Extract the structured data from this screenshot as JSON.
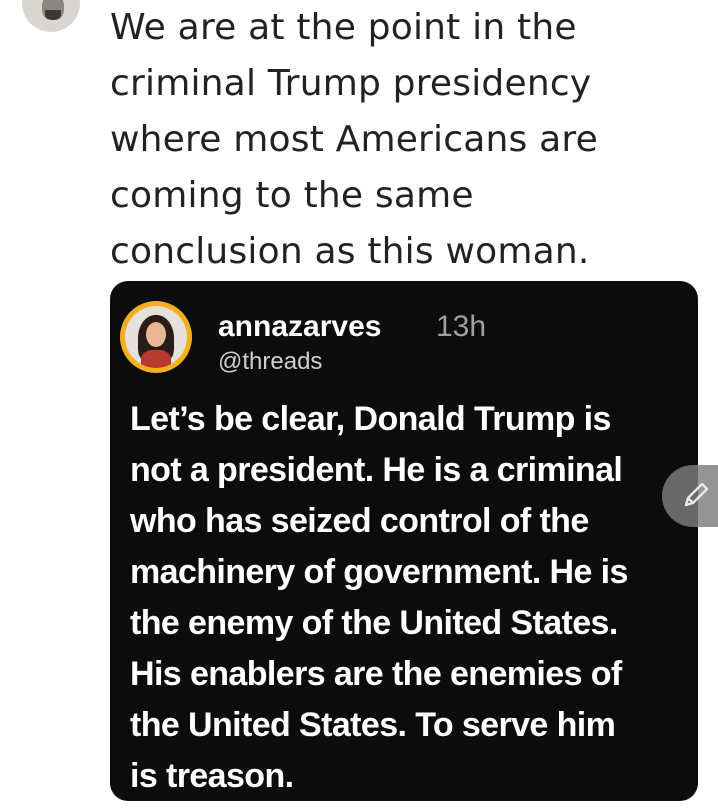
{
  "author": {
    "avatar_icon": "profile-avatar"
  },
  "post": {
    "text": "We are at the point in the\ncriminal Trump presidency\nwhere most Americans are\ncoming to the same\nconclusion as this woman."
  },
  "embedded_card": {
    "avatar_icon": "profile-avatar",
    "username": "annazarves",
    "time": "13h",
    "handle": "@threads",
    "body": "Let’s be clear, Donald Trump is\nnot a president. He is a criminal\nwho has seized control of the\nmachinery of government. He is\nthe enemy of the United States.\nHis enablers are the enemies of\nthe United States. To serve him\nis treason.",
    "accent_color": "#f2b01e",
    "background_color": "#0c0c0c"
  },
  "edit_button": {
    "icon": "pencil-icon"
  }
}
